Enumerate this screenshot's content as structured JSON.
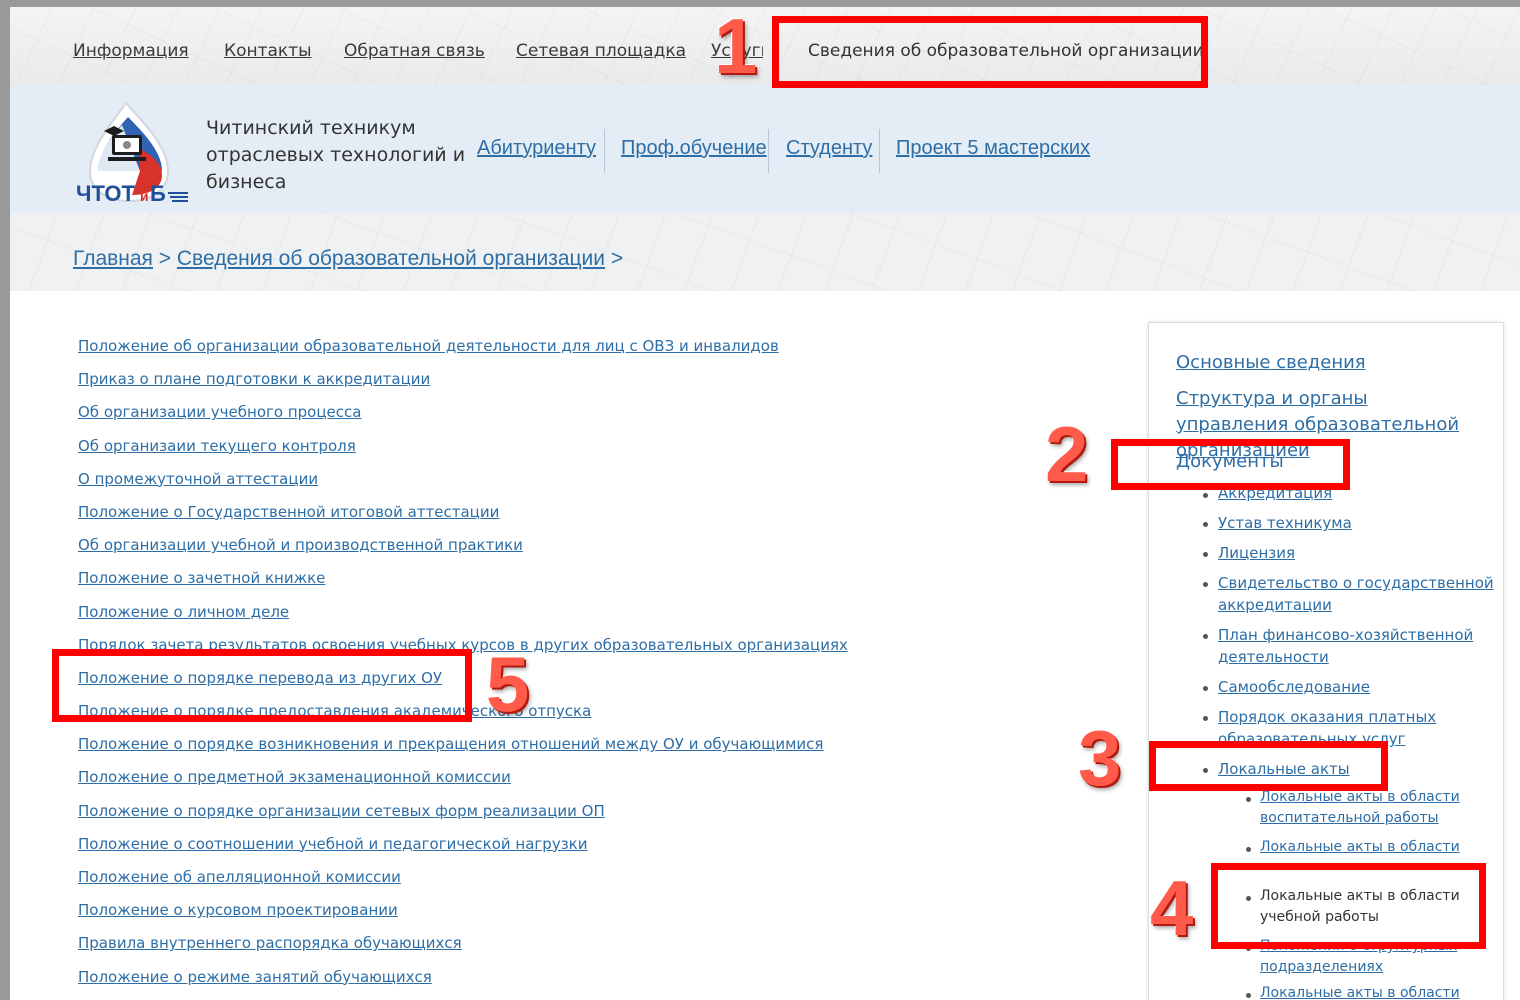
{
  "topnav": {
    "items": [
      "Информация",
      "Контакты",
      "Обратная связь",
      "Сетевая площадка",
      "Услуги"
    ],
    "active": "Сведения об образовательной организации"
  },
  "header": {
    "org_name": "Читинский техникум отраслевых технологий и бизнеса",
    "logo_text": "ЧТОТиБ",
    "menu": [
      "Абитуриенту",
      "Проф.обучение",
      "Студенту",
      "Проект 5 мастерских"
    ]
  },
  "breadcrumb": {
    "home": "Главная",
    "current": "Сведения об образовательной организации",
    "sep": ">"
  },
  "documents": [
    "Положение об организации образовательной деятельности для лиц с ОВЗ и инвалидов",
    "Приказ о плане подготовки к аккредитации",
    "Об организации учебного процесса",
    "Об организаии текущего контроля",
    "О промежуточной аттестации",
    "Положение о Государственной итоговой аттестации",
    "Об организации учебной и производственной практики",
    "Положение о зачетной книжке",
    "Положение о личном деле",
    "Порядок зачета результатов освоения учебных курсов в других образовательных организациях",
    "Положение о порядке перевода из других ОУ",
    "Положение о порядке предоставления академического отпуска",
    "Положение о порядке возникновения и прекращения отношений между ОУ и обучающимися",
    "Положение о предметной экзаменационной комиссии",
    "Положение о порядке организации сетевых форм реализации ОП",
    "Положение о соотношении учебной и педагогической нагрузки",
    "Положение об апелляционной комиссии",
    "Положение о курсовом проектировании",
    "Правила внутреннего распорядка обучающихся",
    "Положение о режиме занятий обучающихся"
  ],
  "sidebar": {
    "basic": "Основные сведения",
    "structure": "Структура и органы управления образовательной организацией",
    "documents": "Документы",
    "doc_items": [
      "Аккредитация",
      "Устав техникума",
      "Лицензия",
      "Свидетельство о государственной аккредитации",
      "План финансово-хозяйственной деятельности",
      "Самообследование",
      "Порядок оказания платных образовательных услуг",
      "Локальные акты"
    ],
    "local_acts": [
      "Локальные акты в области воспитательной работы",
      "Локальные акты в области",
      "Локальные акты в области учебной работы",
      "Положения о структурных подразделениях",
      "Локальные акты в области"
    ]
  },
  "annotations": [
    "1",
    "2",
    "3",
    "4",
    "5"
  ],
  "colors": {
    "link": "#2e6ea6",
    "highlight": "#ff0000",
    "annotation": "#ff5a4a"
  }
}
